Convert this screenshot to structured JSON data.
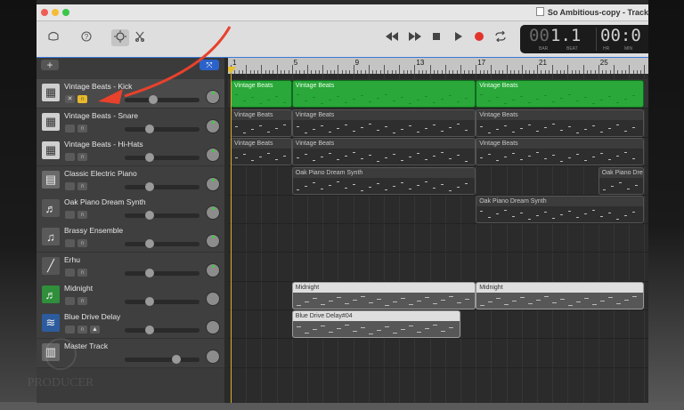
{
  "window": {
    "title": "So Ambitious-copy - Track"
  },
  "toolbar": {
    "icons": [
      "library-icon",
      "help-icon",
      "smart-controls-icon",
      "editors-icon"
    ],
    "lcd": {
      "bar_beat": "1.1",
      "prefix": "00",
      "bar_label": "BAR",
      "beat_label": "BEAT",
      "hr_label": "HR",
      "min_label": "MIN",
      "time": "00:0"
    }
  },
  "track_header": {
    "add_label": "+",
    "smart_label": "⤧"
  },
  "tracks": [
    {
      "name": "Vintage Beats - Kick",
      "icon": "drum-machine-icon",
      "selected": true,
      "mute": "🔇",
      "headphone": "🎧",
      "volume": 0.36,
      "pan_dot": true
    },
    {
      "name": "Vintage Beats - Snare",
      "icon": "drum-machine-icon",
      "selected": false,
      "mute": "",
      "headphone": "🎧",
      "volume": 0.31,
      "pan_dot": true
    },
    {
      "name": "Vintage Beats - Hi-Hats",
      "icon": "drum-machine-icon",
      "selected": false,
      "mute": "",
      "headphone": "🎧",
      "volume": 0.31,
      "pan_dot": true
    },
    {
      "name": "Classic Electric Piano",
      "icon": "electric-piano-icon",
      "selected": false,
      "mute": "",
      "headphone": "🎧",
      "volume": 0.31,
      "pan_dot": true
    },
    {
      "name": "Oak Piano Dream Synth",
      "icon": "grand-piano-icon",
      "selected": false,
      "mute": "",
      "headphone": "🎧",
      "volume": 0.31,
      "pan_dot": true
    },
    {
      "name": "Brassy Ensemble",
      "icon": "brass-icon",
      "selected": false,
      "mute": "",
      "headphone": "🎧",
      "volume": 0.31,
      "pan_dot": true
    },
    {
      "name": "Erhu",
      "icon": "erhu-icon",
      "selected": false,
      "mute": "",
      "headphone": "🎧",
      "volume": 0.31,
      "pan_dot": true
    },
    {
      "name": "Midnight",
      "icon": "music-note-icon",
      "selected": false,
      "mute": "",
      "headphone": "🎧",
      "volume": 0.31,
      "pan_dot": false
    },
    {
      "name": "Blue Drive Delay",
      "icon": "waveform-icon",
      "selected": false,
      "mute": "",
      "headphone": "🎧",
      "volume": 0.31,
      "pan_dot": false
    },
    {
      "name": "Master Track",
      "icon": "master-icon",
      "selected": false,
      "mute": "",
      "headphone": "",
      "volume": 0.72,
      "pan_dot": false
    }
  ],
  "ruler": {
    "bars": [
      "1",
      "5",
      "9",
      "13",
      "17",
      "21",
      "25"
    ]
  },
  "regions": {
    "kick_1": "Vintage Beats",
    "kick_2": "Vintage Beats",
    "kick_3": "Vintage Beats",
    "snare_1": "Vintage Beats",
    "snare_2": "Vintage Beats",
    "snare_3": "Vintage Beats",
    "hats_1": "Vintage Beats",
    "hats_2": "Vintage Beats",
    "hats_3": "Vintage Beats",
    "ep_1": "Oak Piano Dream Synth",
    "ep_2": "Oak Piano Dream Synth",
    "synth_1": "Oak Piano Dream Synth",
    "midnight_1": "Midnight",
    "midnight_2": "Midnight",
    "blue_1": "Blue Drive Delay#04"
  },
  "watermark": {
    "text": "PRODUCER"
  },
  "colors": {
    "accent": "#2a62c9",
    "region_green": "#2aa83a",
    "playhead": "#e8c02c",
    "arrow": "#e8412c"
  }
}
